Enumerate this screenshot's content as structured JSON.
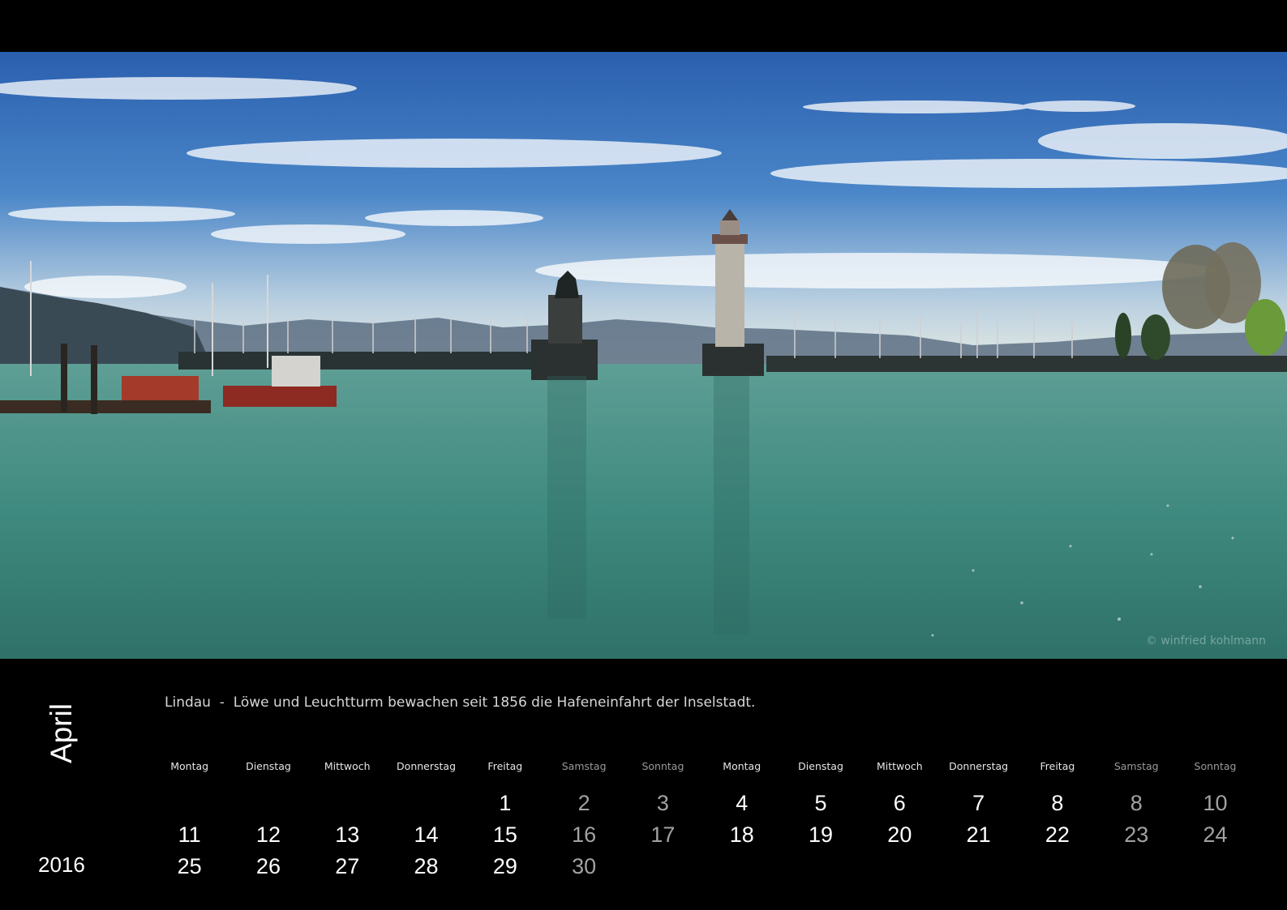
{
  "photo": {
    "credit": "© winfried kohlmann",
    "colors": {
      "sky_top": "#2f67b6",
      "sky_horizon": "#dbe4e6",
      "water": "#4b8f86"
    }
  },
  "calendar": {
    "month": "April",
    "year": "2016",
    "caption": "Lindau  -  Löwe und Leuchtturm bewachen seit 1856 die Hafeneinfahrt der Inselstadt.",
    "weekdays": [
      "Montag",
      "Dienstag",
      "Mittwoch",
      "Donnerstag",
      "Freitag",
      "Samstag",
      "Sonntag",
      "Montag",
      "Dienstag",
      "Mittwoch",
      "Donnerstag",
      "Freitag",
      "Samstag",
      "Sonntag"
    ],
    "rows": [
      [
        "",
        "",
        "",
        "",
        "1",
        "2",
        "3",
        "4",
        "5",
        "6",
        "7",
        "8",
        "8",
        "10"
      ],
      [
        "11",
        "12",
        "13",
        "14",
        "15",
        "16",
        "17",
        "18",
        "19",
        "20",
        "21",
        "22",
        "23",
        "24"
      ],
      [
        "25",
        "26",
        "27",
        "28",
        "29",
        "30",
        "",
        "",
        "",
        "",
        "",
        "",
        "",
        ""
      ]
    ]
  }
}
